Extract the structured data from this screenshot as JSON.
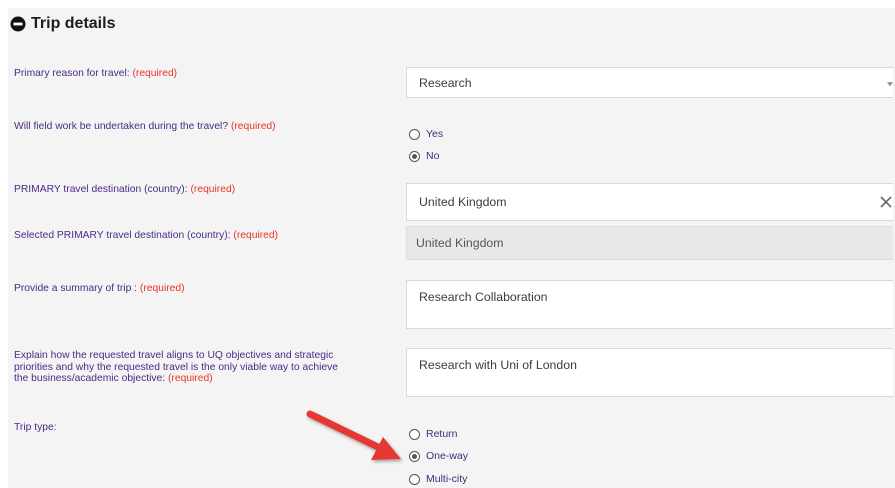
{
  "section": {
    "title": "Trip details",
    "icon": "collapse-minus-icon"
  },
  "required_text": "(required)",
  "fields": {
    "primary_reason": {
      "label": "Primary reason for travel:",
      "value": "Research"
    },
    "field_work": {
      "label": "Will field work be undertaken during the travel?",
      "options": [
        "Yes",
        "No"
      ],
      "selected": "No"
    },
    "destination": {
      "label": "PRIMARY travel destination (country):",
      "value": "United Kingdom"
    },
    "selected_destination": {
      "label": "Selected PRIMARY travel destination (country):",
      "value": "United Kingdom"
    },
    "summary": {
      "label": "Provide a summary of trip :",
      "value": "Research Collaboration"
    },
    "alignment": {
      "label_lines": [
        "Explain how the requested travel aligns to UQ objectives and strategic",
        "priorities and why the requested travel is the only viable way to achieve",
        "the business/academic objective:"
      ],
      "value": "Research with Uni of London"
    },
    "trip_type": {
      "label": "Trip type:",
      "options": [
        "Return",
        "One-way",
        "Multi-city"
      ],
      "selected": "One-way"
    }
  },
  "colors": {
    "label": "#4a2a86",
    "required": "#e8352a",
    "arrow": "#e53935",
    "panel_bg": "#f4f4f4"
  },
  "annotation": {
    "type": "red-arrow",
    "points_to": "One-way"
  }
}
